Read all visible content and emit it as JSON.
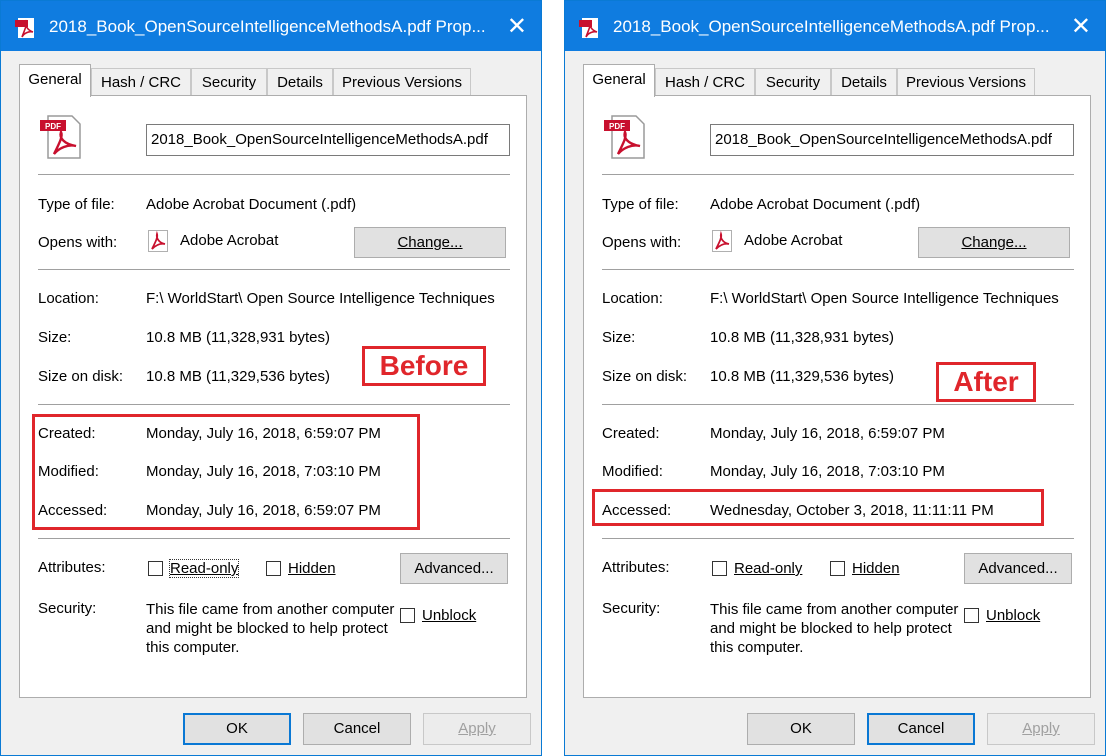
{
  "colors": {
    "titlebar": "#0f7ce0",
    "highlight": "#e0262b",
    "default_button_border": "#0a78d4"
  },
  "icons": {
    "pdf": "pdf-file-icon",
    "acrobat": "adobe-acrobat-icon",
    "close": "close-icon"
  },
  "dialogs": [
    {
      "title": "2018_Book_OpenSourceIntelligenceMethodsA.pdf Prop...",
      "tabs": [
        "General",
        "Hash / CRC",
        "Security",
        "Details",
        "Previous Versions"
      ],
      "filename": "2018_Book_OpenSourceIntelligenceMethodsA.pdf",
      "type_label": "Type of file:",
      "type_value": "Adobe Acrobat Document (.pdf)",
      "opens_label": "Opens with:",
      "opens_value": "Adobe Acrobat",
      "change_button": "Change...",
      "location_label": "Location:",
      "location_value": "F:\\ WorldStart\\ Open Source Intelligence Techniques",
      "size_label": "Size:",
      "size_value": "10.8 MB (11,328,931 bytes)",
      "size_disk_label": "Size on disk:",
      "size_disk_value": "10.8 MB (11,329,536 bytes)",
      "created_label": "Created:",
      "created_value": "Monday, July 16, 2018, 6:59:07 PM",
      "modified_label": "Modified:",
      "modified_value": "Monday, July 16, 2018, 7:03:10 PM",
      "accessed_label": "Accessed:",
      "accessed_value": "Monday, July 16, 2018, 6:59:07 PM",
      "attributes_label": "Attributes:",
      "readonly_label": "Read-only",
      "hidden_label": "Hidden",
      "advanced_button": "Advanced...",
      "security_label": "Security:",
      "security_text": "This file came from another computer and might be blocked to help protect this computer.",
      "unblock_label": "Unblock",
      "ok_button": "OK",
      "cancel_button": "Cancel",
      "apply_button": "Apply",
      "callout": "Before"
    },
    {
      "title": "2018_Book_OpenSourceIntelligenceMethodsA.pdf Prop...",
      "tabs": [
        "General",
        "Hash / CRC",
        "Security",
        "Details",
        "Previous Versions"
      ],
      "filename": "2018_Book_OpenSourceIntelligenceMethodsA.pdf",
      "type_label": "Type of file:",
      "type_value": "Adobe Acrobat Document (.pdf)",
      "opens_label": "Opens with:",
      "opens_value": "Adobe Acrobat",
      "change_button": "Change...",
      "location_label": "Location:",
      "location_value": "F:\\ WorldStart\\ Open Source Intelligence Techniques",
      "size_label": "Size:",
      "size_value": "10.8 MB (11,328,931 bytes)",
      "size_disk_label": "Size on disk:",
      "size_disk_value": "10.8 MB (11,329,536 bytes)",
      "created_label": "Created:",
      "created_value": "Monday, July 16, 2018, 6:59:07 PM",
      "modified_label": "Modified:",
      "modified_value": "Monday, July 16, 2018, 7:03:10 PM",
      "accessed_label": "Accessed:",
      "accessed_value": "Wednesday, October 3, 2018, 11:11:11 PM",
      "attributes_label": "Attributes:",
      "readonly_label": "Read-only",
      "hidden_label": "Hidden",
      "advanced_button": "Advanced...",
      "security_label": "Security:",
      "security_text": "This file came from another computer and might be blocked to help protect this computer.",
      "unblock_label": "Unblock",
      "ok_button": "OK",
      "cancel_button": "Cancel",
      "apply_button": "Apply",
      "callout": "After"
    }
  ]
}
